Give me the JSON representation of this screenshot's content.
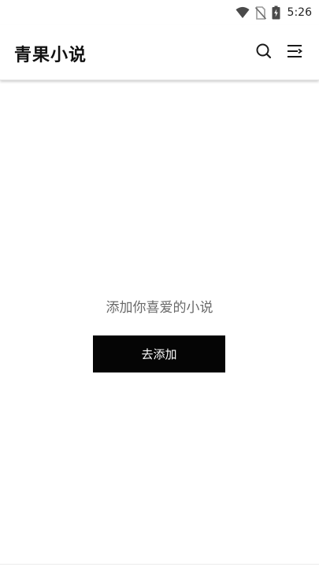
{
  "status_bar": {
    "time": "5:26",
    "icons": [
      "wifi-icon",
      "no-sim-icon",
      "battery-charging-icon"
    ]
  },
  "app_bar": {
    "title": "青果小说",
    "actions": [
      "search-icon",
      "menu-icon"
    ]
  },
  "empty_state": {
    "message": "添加你喜爱的小说",
    "button_label": "去添加"
  }
}
